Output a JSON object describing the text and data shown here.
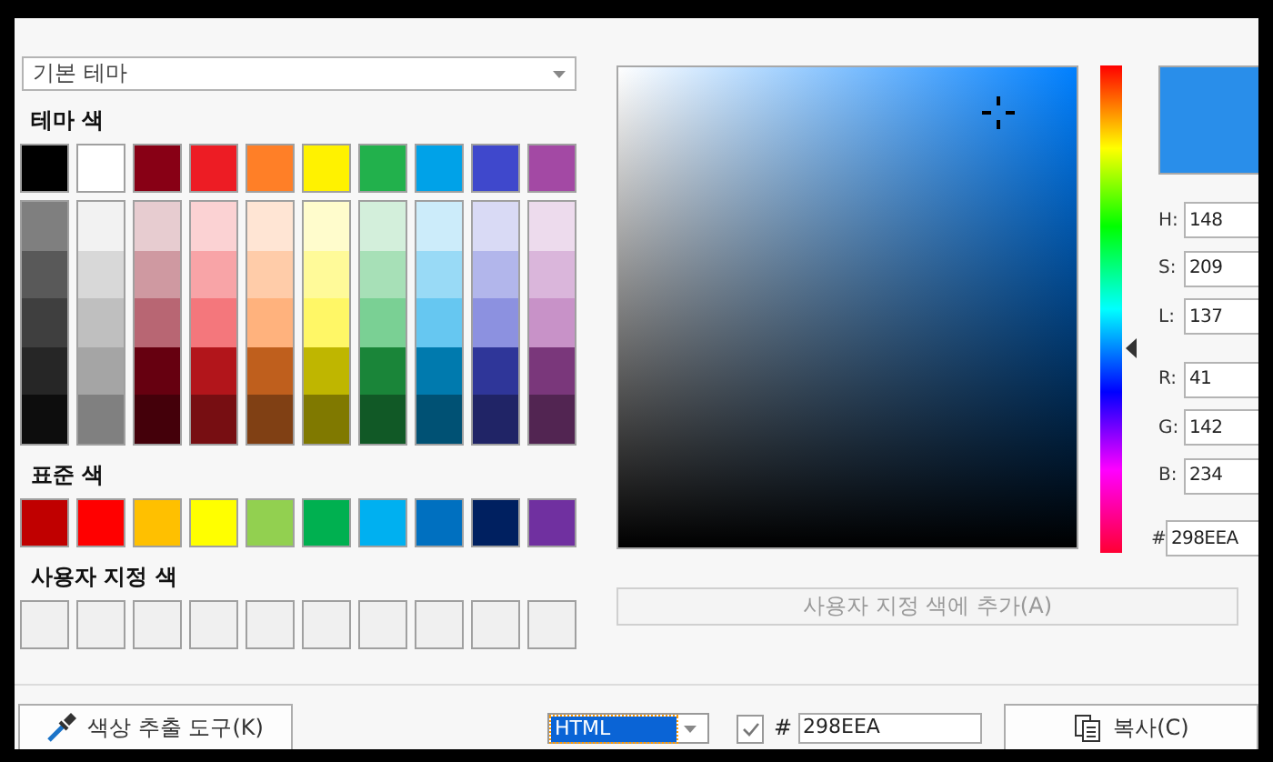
{
  "theme_dropdown": {
    "value": "기본 테마"
  },
  "theme_label": "테마 색",
  "theme_colors": [
    {
      "color": "#000000",
      "shades": [
        {
          "color": "#7f7f7f"
        },
        {
          "color": "#595959"
        },
        {
          "color": "#3f3f3f"
        },
        {
          "color": "#262626"
        },
        {
          "color": "#0d0d0d"
        }
      ]
    },
    {
      "color": "#ffffff",
      "shades": [
        {
          "color": "#f2f2f2"
        },
        {
          "color": "#d8d8d8"
        },
        {
          "color": "#bfbfbf"
        },
        {
          "color": "#a5a5a5"
        },
        {
          "color": "#808080"
        }
      ]
    },
    {
      "color": "#880015",
      "shades": [
        {
          "color": "#e7ccd0"
        },
        {
          "color": "#cf99a1"
        },
        {
          "color": "#b86673"
        },
        {
          "color": "#660010"
        },
        {
          "color": "#44000a"
        }
      ]
    },
    {
      "color": "#ed1c24",
      "shades": [
        {
          "color": "#fbd2d3"
        },
        {
          "color": "#f8a4a7"
        },
        {
          "color": "#f4777c"
        },
        {
          "color": "#b2151b"
        },
        {
          "color": "#770e12"
        }
      ]
    },
    {
      "color": "#ff7f27",
      "shades": [
        {
          "color": "#ffe5d4"
        },
        {
          "color": "#ffcca9"
        },
        {
          "color": "#ffb27d"
        },
        {
          "color": "#bf5f1d"
        },
        {
          "color": "#804014"
        }
      ]
    },
    {
      "color": "#fff200",
      "shades": [
        {
          "color": "#fffccc"
        },
        {
          "color": "#fffa99"
        },
        {
          "color": "#fff766"
        },
        {
          "color": "#bfb600"
        },
        {
          "color": "#807900"
        }
      ]
    },
    {
      "color": "#22b14c",
      "shades": [
        {
          "color": "#d3efdb"
        },
        {
          "color": "#a7e0b7"
        },
        {
          "color": "#7ad094"
        },
        {
          "color": "#1a8539"
        },
        {
          "color": "#115926"
        }
      ]
    },
    {
      "color": "#00a2e8",
      "shades": [
        {
          "color": "#ccecfa"
        },
        {
          "color": "#99daf6"
        },
        {
          "color": "#66c7f1"
        },
        {
          "color": "#007aae"
        },
        {
          "color": "#005174"
        }
      ]
    },
    {
      "color": "#3f48cc",
      "shades": [
        {
          "color": "#d9daf5"
        },
        {
          "color": "#b2b6eb"
        },
        {
          "color": "#8c91e0"
        },
        {
          "color": "#2f3699"
        },
        {
          "color": "#202466"
        }
      ]
    },
    {
      "color": "#a349a4",
      "shades": [
        {
          "color": "#eddbed"
        },
        {
          "color": "#dab6db"
        },
        {
          "color": "#c892c8"
        },
        {
          "color": "#7a377b"
        },
        {
          "color": "#522552"
        }
      ]
    }
  ],
  "standard_label": "표준 색",
  "standard_colors": [
    {
      "color": "#c00000"
    },
    {
      "color": "#ff0000"
    },
    {
      "color": "#ffc000"
    },
    {
      "color": "#ffff00"
    },
    {
      "color": "#92d050"
    },
    {
      "color": "#00b050"
    },
    {
      "color": "#00b0f0"
    },
    {
      "color": "#0070c0"
    },
    {
      "color": "#002060"
    },
    {
      "color": "#7030a0"
    }
  ],
  "custom_label": "사용자 지정 색",
  "custom_colors": [
    {
      "filled": false
    },
    {
      "filled": false
    },
    {
      "filled": false
    },
    {
      "filled": false
    },
    {
      "filled": false
    },
    {
      "filled": false
    },
    {
      "filled": false
    },
    {
      "filled": false
    },
    {
      "filled": false
    },
    {
      "filled": false
    }
  ],
  "hue_slider": {
    "level": 0.58
  },
  "preview": {
    "color": "#298eea"
  },
  "hsl_fields": [
    {
      "label": "H:",
      "value": "148"
    },
    {
      "label": "S:",
      "value": "209"
    },
    {
      "label": "L:",
      "value": "137"
    }
  ],
  "rgb_fields": [
    {
      "label": "R:",
      "value": "41"
    },
    {
      "label": "G:",
      "value": "142"
    },
    {
      "label": "B:",
      "value": "234"
    }
  ],
  "hex_field": {
    "label": "#",
    "value": "298EEA"
  },
  "add_custom_button": {
    "label": "사용자 지정 색에 추가(A)",
    "disabled": true
  },
  "picker_button": "색상 추출 도구(K)",
  "format_select": {
    "value": "HTML",
    "focused": true
  },
  "hash_checkbox": {
    "checked": true
  },
  "bottom_hex": {
    "label": "#",
    "value": "298EEA"
  },
  "copy_button": "복사(C)"
}
